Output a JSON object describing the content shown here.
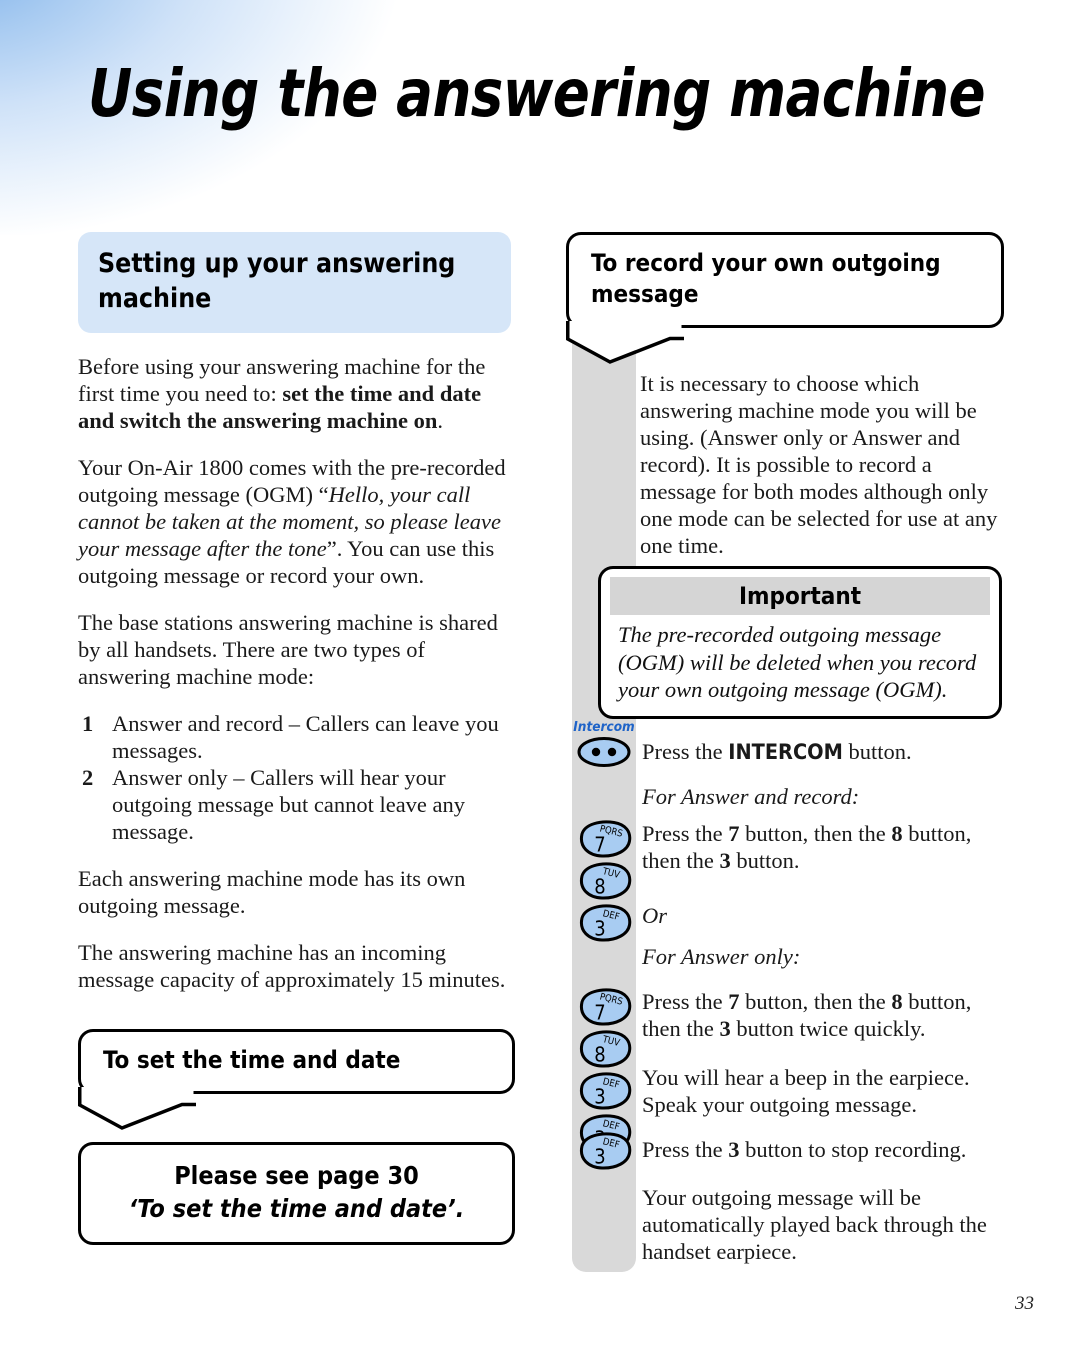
{
  "page": {
    "title": "Using the answering machine",
    "number": "33"
  },
  "left_column": {
    "heading": "Setting up your answering machine",
    "paragraph_1": {
      "plain_1": "Before using your answering machine for the first time you need to: ",
      "bold_1": "set the time and date and switch the answering machine on",
      "plain_2": "."
    },
    "paragraph_2": {
      "plain_1": "Your On-Air 1800 comes with the pre-recorded outgoing message (OGM) “",
      "italic_1": "Hello, your call cannot be taken at the moment, so please leave your message after the tone",
      "plain_2": "”. You can use this outgoing message or record your own."
    },
    "paragraph_3": "The base stations answering machine is shared by all handsets. There are two types of answering machine mode:",
    "list": [
      {
        "number": "1",
        "text": "Answer and record – Callers can leave you messages."
      },
      {
        "number": "2",
        "text": "Answer only – Callers will hear your outgoing message but cannot leave any message."
      }
    ],
    "paragraph_4": "Each answering machine mode has its own outgoing message.",
    "paragraph_5": "The answering machine has an incoming message capacity of approximately 15 minutes.",
    "bubble_heading": "To set the time and date",
    "see_page_box": {
      "line_1": "Please see page 30",
      "line_2": "‘To set the time and date’."
    }
  },
  "right_column": {
    "bubble_heading": "To record your own outgoing message",
    "intro_paragraph": "It is necessary to choose which answering machine mode you will be using. (Answer only or Answer and record). It is possible to record a message for both modes although only one mode can be selected for use at any one time.",
    "important": {
      "banner": "Important",
      "text": "The pre-recorded outgoing message (OGM) will be deleted when you record your own outgoing message (OGM)."
    },
    "steps": [
      {
        "keys": [
          {
            "type": "intercom",
            "caption": "Intercom"
          }
        ],
        "text_parts": {
          "plain_1": "Press the ",
          "sans_bold": "INTERCOM",
          "plain_2": " button."
        }
      },
      {
        "keys": [],
        "italic_text": "For Answer and record:"
      },
      {
        "keys": [
          {
            "type": "digit",
            "digit": "7",
            "letters": "PQRS"
          },
          {
            "type": "digit",
            "digit": "8",
            "letters": "TUV"
          },
          {
            "type": "digit",
            "digit": "3",
            "letters": "DEF"
          }
        ],
        "text_parts": {
          "plain_1": "Press the ",
          "b1": "7",
          "plain_2": " button, then the ",
          "b2": "8",
          "plain_3": " button, then the ",
          "b3": "3",
          "plain_4": " button."
        }
      },
      {
        "keys": [],
        "italic_text": "Or"
      },
      {
        "keys": [],
        "italic_text": "For Answer only:"
      },
      {
        "keys": [
          {
            "type": "digit",
            "digit": "7",
            "letters": "PQRS"
          },
          {
            "type": "digit",
            "digit": "8",
            "letters": "TUV"
          },
          {
            "type": "digit",
            "digit": "3",
            "letters": "DEF"
          },
          {
            "type": "digit",
            "digit": "3",
            "letters": "DEF"
          }
        ],
        "text_parts": {
          "plain_1": "Press the ",
          "b1": "7",
          "plain_2": " button, then the ",
          "b2": "8",
          "plain_3": " button, then the ",
          "b3": "3",
          "plain_4": " button twice quickly."
        }
      },
      {
        "keys": [],
        "text": "You will hear a beep in the earpiece. Speak your outgoing message."
      },
      {
        "keys": [
          {
            "type": "digit",
            "digit": "3",
            "letters": "DEF"
          }
        ],
        "text_parts": {
          "plain_1": "Press the ",
          "b1": "3",
          "plain_2": " button to stop recording."
        }
      },
      {
        "keys": [],
        "text": "Your outgoing message will be automatically played back through the handset earpiece."
      }
    ]
  },
  "colors": {
    "heading_panel": "#d6e6f8",
    "gray_rail": "#d9d9d9",
    "key_blue": "#a8ccf2",
    "intercom_caption": "#1e63c8",
    "important_banner": "#d5d5d5"
  }
}
